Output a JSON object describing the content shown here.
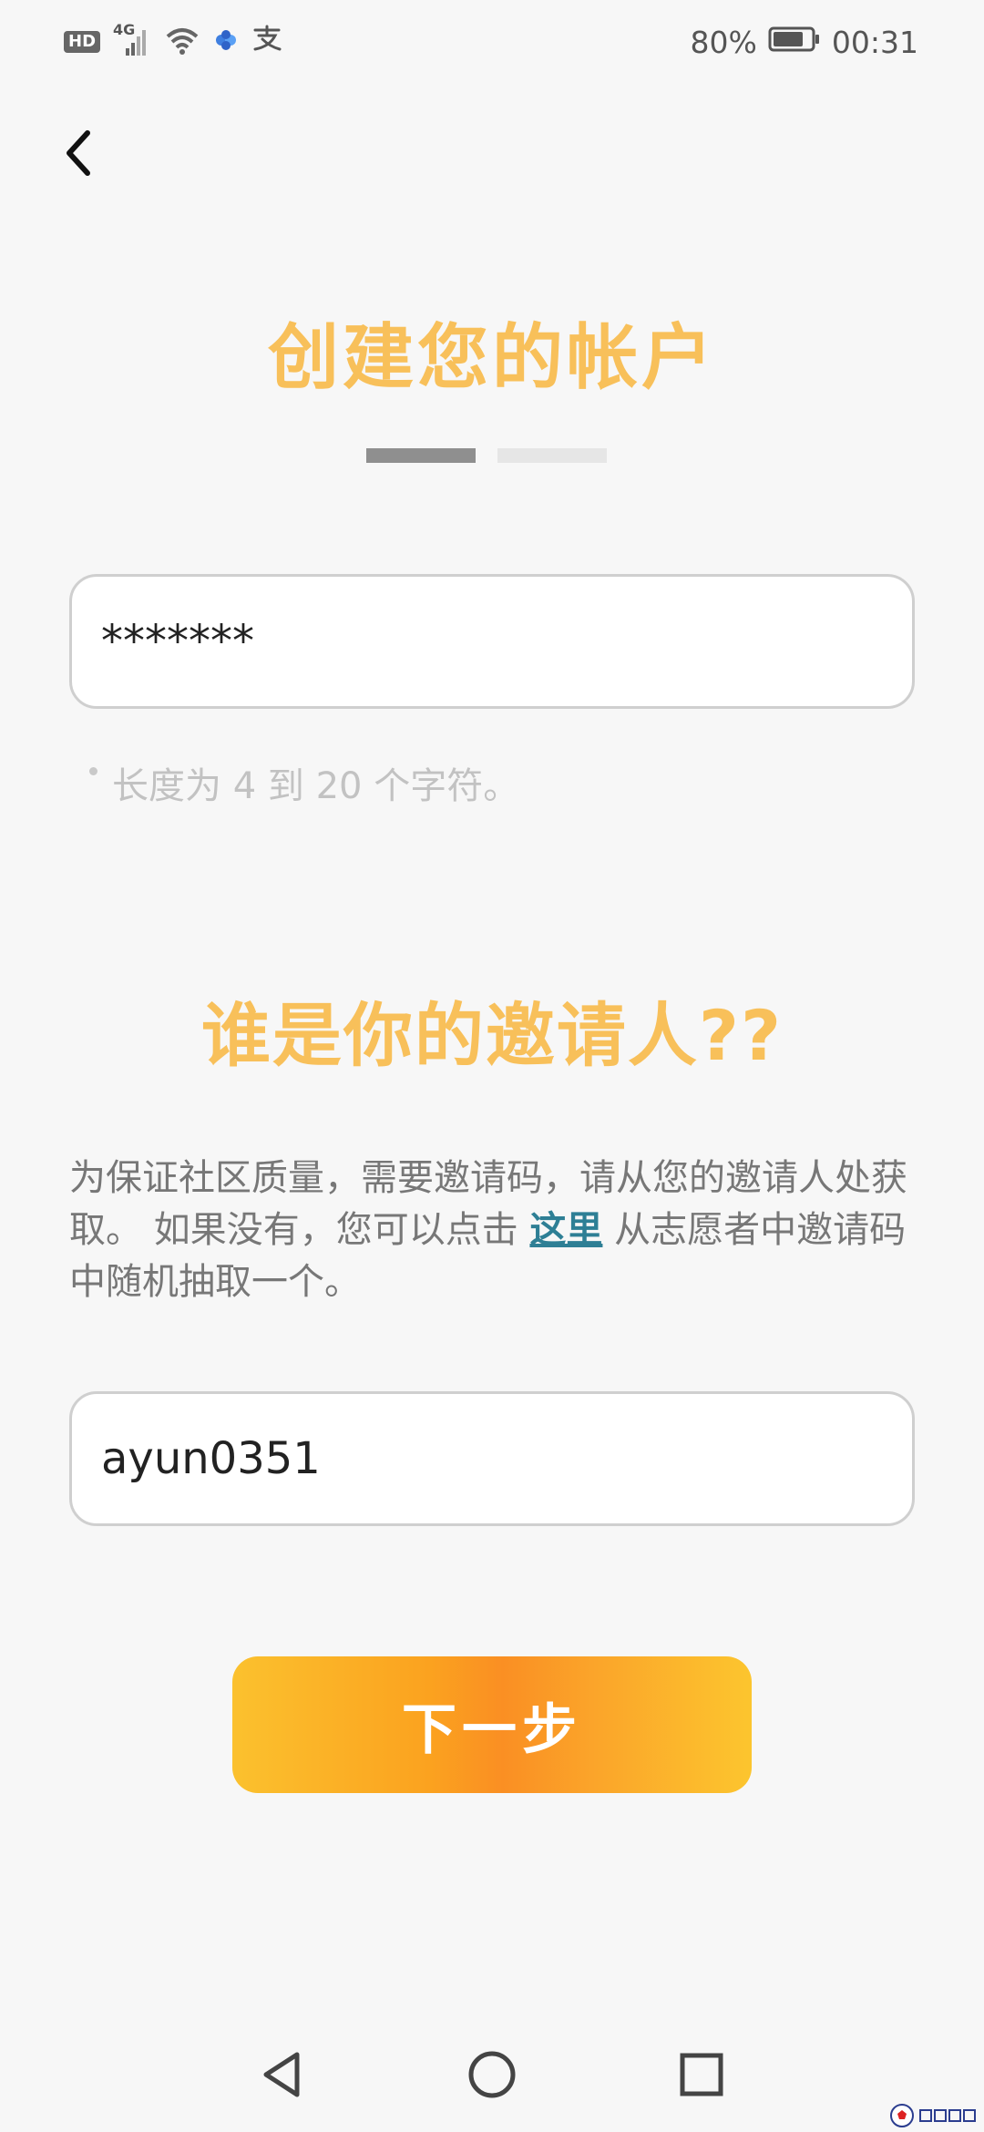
{
  "status_bar": {
    "hd_label": "HD",
    "network_label": "4G",
    "battery_percent": "80%",
    "battery_level": 0.8,
    "time": "00:31"
  },
  "header": {
    "back_icon": "chevron-left-icon"
  },
  "step1": {
    "title": "创建您的帐户",
    "password_value": "*******",
    "hint": "长度为 4 到 20 个字符。"
  },
  "steps": {
    "total": 2,
    "current": 1
  },
  "step2": {
    "title": "谁是你的邀请人??",
    "description_before": "为保证社区质量，需要邀请码，请从您的邀请人处获取。 如果没有，您可以点击 ",
    "description_link": "这里",
    "description_after": " 从志愿者中邀请码中随机抽取一个。",
    "invite_value": "ayun0351"
  },
  "actions": {
    "next_label": "下一步"
  },
  "nav": {
    "back_icon": "triangle-back-icon",
    "home_icon": "circle-home-icon",
    "recent_icon": "square-recent-icon"
  },
  "colors": {
    "title": "#f8c05a",
    "link": "#2e7f95",
    "button_start": "#fbc12e",
    "button_mid": "#fa8f23"
  }
}
